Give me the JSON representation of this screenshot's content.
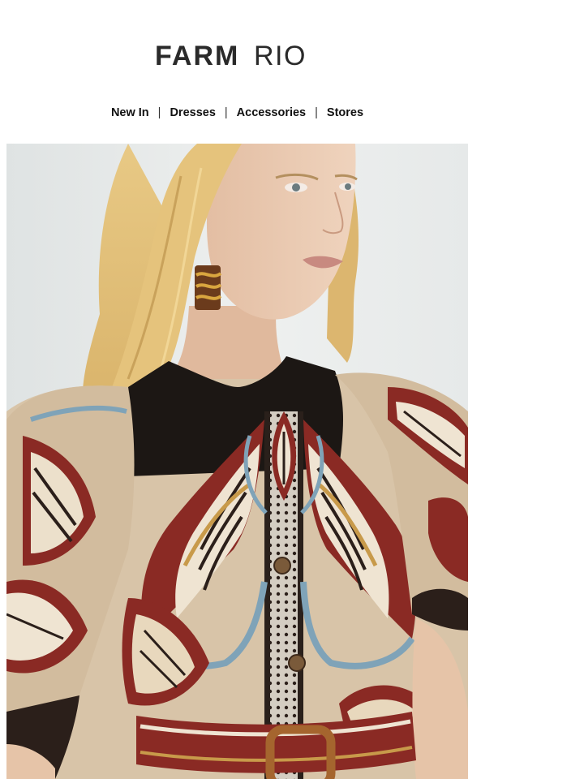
{
  "brand": {
    "logo_word_1": "FARM",
    "logo_word_2": "RIO",
    "logo_color": "#2a2a2a"
  },
  "nav": {
    "items": [
      "New In",
      "Dresses",
      "Accessories",
      "Stores"
    ],
    "separator": "|"
  },
  "hero": {
    "image": "model-photo",
    "colors": {
      "background": "#e9ecec",
      "dress_beige": "#d8c4a8",
      "dress_black": "#1c1714",
      "print_red": "#8a2a24",
      "print_blue": "#7fa3b8",
      "print_gold": "#c89a4a",
      "hair": "#e2c07a",
      "skin": "#e9c7ad"
    }
  }
}
